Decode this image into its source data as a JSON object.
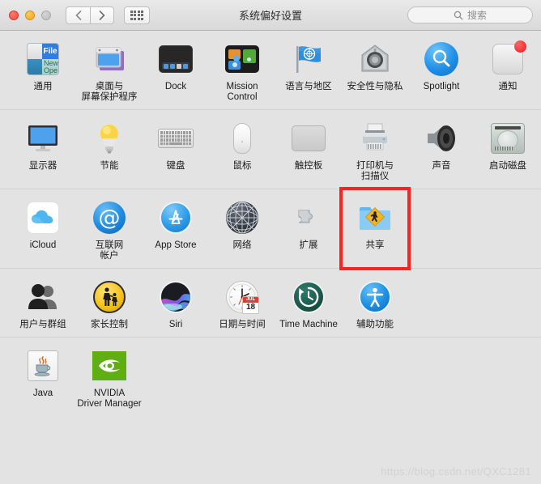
{
  "window": {
    "title": "系统偏好设置",
    "traffic_lights": [
      "close",
      "minimize",
      "zoom"
    ],
    "nav": {
      "back": "back-arrow",
      "forward": "forward-arrow",
      "grid": "show-all-grid"
    },
    "search": {
      "placeholder": "搜索",
      "value": "",
      "icon": "search-icon"
    }
  },
  "highlight": {
    "target": "共享",
    "color": "#fb2222"
  },
  "watermark": "https://blog.csdn.net/QXC1281",
  "rows": [
    {
      "items": [
        {
          "label": "通用",
          "icon": "general-icon"
        },
        {
          "label": "桌面与\n屏幕保护程序",
          "icon": "desktop-screensaver-icon"
        },
        {
          "label": "Dock",
          "icon": "dock-icon"
        },
        {
          "label": "Mission\nControl",
          "icon": "mission-control-icon"
        },
        {
          "label": "语言与地区",
          "icon": "language-region-icon"
        },
        {
          "label": "安全性与隐私",
          "icon": "security-privacy-icon"
        },
        {
          "label": "Spotlight",
          "icon": "spotlight-icon"
        },
        {
          "label": "通知",
          "icon": "notifications-icon",
          "badge": true
        }
      ]
    },
    {
      "items": [
        {
          "label": "显示器",
          "icon": "displays-icon"
        },
        {
          "label": "节能",
          "icon": "energy-saver-icon"
        },
        {
          "label": "键盘",
          "icon": "keyboard-icon"
        },
        {
          "label": "鼠标",
          "icon": "mouse-icon"
        },
        {
          "label": "触控板",
          "icon": "trackpad-icon"
        },
        {
          "label": "打印机与\n扫描仪",
          "icon": "printers-scanners-icon"
        },
        {
          "label": "声音",
          "icon": "sound-icon"
        },
        {
          "label": "启动磁盘",
          "icon": "startup-disk-icon"
        }
      ]
    },
    {
      "items": [
        {
          "label": "iCloud",
          "icon": "icloud-icon"
        },
        {
          "label": "互联网\n帐户",
          "icon": "internet-accounts-icon"
        },
        {
          "label": "App Store",
          "icon": "app-store-icon"
        },
        {
          "label": "网络",
          "icon": "network-icon"
        },
        {
          "label": "扩展",
          "icon": "extensions-icon"
        },
        {
          "label": "共享",
          "icon": "sharing-icon",
          "highlighted": true
        }
      ]
    },
    {
      "items": [
        {
          "label": "用户与群组",
          "icon": "users-groups-icon"
        },
        {
          "label": "家长控制",
          "icon": "parental-controls-icon"
        },
        {
          "label": "Siri",
          "icon": "siri-icon"
        },
        {
          "label": "日期与时间",
          "icon": "date-time-icon",
          "calendar_month": "JUL",
          "calendar_day": "18"
        },
        {
          "label": "Time Machine",
          "icon": "time-machine-icon"
        },
        {
          "label": "辅助功能",
          "icon": "accessibility-icon"
        }
      ]
    },
    {
      "items": [
        {
          "label": "Java",
          "icon": "java-icon"
        },
        {
          "label": "NVIDIA\nDriver Manager",
          "icon": "nvidia-driver-manager-icon"
        }
      ]
    }
  ],
  "general_icon_text": {
    "file": "File",
    "new": "New",
    "open": "Ope"
  }
}
